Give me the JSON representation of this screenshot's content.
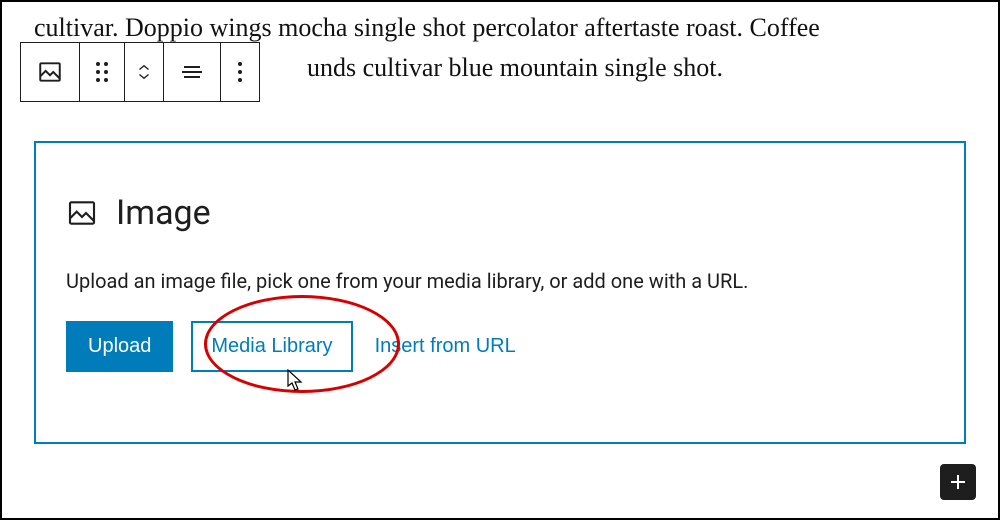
{
  "paragraph": {
    "line1": "cultivar. Doppio wings mocha single shot percolator aftertaste roast. Coffee",
    "line2_indent": "                                          unds cultivar blue mountain single shot."
  },
  "toolbar": {
    "block_type_icon": "image-icon",
    "drag_icon": "drag-handle-icon",
    "move_up_icon": "chevron-up-icon",
    "move_down_icon": "chevron-down-icon",
    "align_icon": "align-icon",
    "more_icon": "more-options-icon"
  },
  "image_block": {
    "title": "Image",
    "description": "Upload an image file, pick one from your media library, or add one with a URL.",
    "upload_label": "Upload",
    "media_library_label": "Media Library",
    "insert_url_label": "Insert from URL"
  },
  "add_block_icon": "plus-icon",
  "annotation": {
    "highlight_target": "media_library_button",
    "color": "#d60000"
  },
  "colors": {
    "accent": "#007cba",
    "text": "#1e1e1e"
  }
}
